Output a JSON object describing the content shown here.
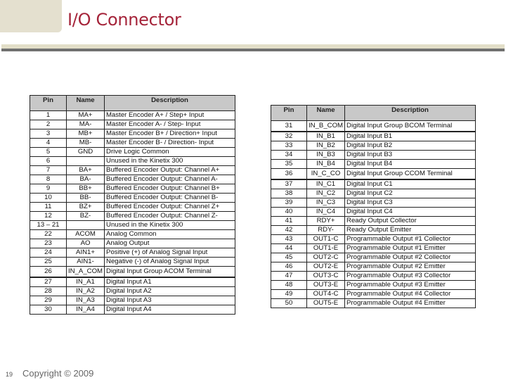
{
  "header": {
    "title": "I/O Connector"
  },
  "tables": {
    "left": {
      "columns": [
        "Pin",
        "Name",
        "Description"
      ],
      "rows": [
        {
          "pin": "1",
          "name": "MA+",
          "desc": "Master Encoder A+ / Step+ Input"
        },
        {
          "pin": "2",
          "name": "MA-",
          "desc": "Master Encoder A- / Step- Input"
        },
        {
          "pin": "3",
          "name": "MB+",
          "desc": "Master Encoder B+ / Direction+ Input"
        },
        {
          "pin": "4",
          "name": "MB-",
          "desc": "Master Encoder B- / Direction- Input"
        },
        {
          "pin": "5",
          "name": "GND",
          "desc": "Drive Logic Common"
        },
        {
          "pin": "6",
          "name": "",
          "desc": "Unused in the Kinetix 300"
        },
        {
          "pin": "7",
          "name": "BA+",
          "desc": "Buffered Encoder Output: Channel A+"
        },
        {
          "pin": "8",
          "name": "BA-",
          "desc": "Buffered Encoder Output: Channel A-"
        },
        {
          "pin": "9",
          "name": "BB+",
          "desc": "Buffered Encoder Output: Channel B+"
        },
        {
          "pin": "10",
          "name": "BB-",
          "desc": "Buffered Encoder Output: Channel B-"
        },
        {
          "pin": "11",
          "name": "BZ+",
          "desc": "Buffered Encoder Output: Channel Z+"
        },
        {
          "pin": "12",
          "name": "BZ-",
          "desc": "Buffered Encoder Output: Channel Z-"
        },
        {
          "pin": "13 – 21",
          "name": "",
          "desc": "Unused in the Kinetix 300"
        },
        {
          "pin": "22",
          "name": "ACOM",
          "desc": "Analog Common"
        },
        {
          "pin": "23",
          "name": "AO",
          "desc": "Analog Output"
        },
        {
          "pin": "24",
          "name": "AIN1+",
          "desc": "Positive (+) of Analog Signal Input"
        },
        {
          "pin": "25",
          "name": "AIN1-",
          "desc": "Negative (-) of Analog Signal Input"
        },
        {
          "pin": "26",
          "name": "IN_A_COM",
          "desc": "Digital Input Group ACOM Terminal"
        },
        {
          "pin": "27",
          "name": "IN_A1",
          "desc": "Digital Input A1"
        },
        {
          "pin": "28",
          "name": "IN_A2",
          "desc": "Digital Input A2"
        },
        {
          "pin": "29",
          "name": "IN_A3",
          "desc": "Digital Input A3"
        },
        {
          "pin": "30",
          "name": "IN_A4",
          "desc": "Digital Input A4"
        }
      ]
    },
    "right": {
      "columns": [
        "Pin",
        "Name",
        "Description"
      ],
      "rows": [
        {
          "pin": "31",
          "name": "IN_B_COM",
          "desc": "Digital Input Group BCOM Terminal"
        },
        {
          "pin": "32",
          "name": "IN_B1",
          "desc": "Digital Input B1"
        },
        {
          "pin": "33",
          "name": "IN_B2",
          "desc": "Digital Input B2"
        },
        {
          "pin": "34",
          "name": "IN_B3",
          "desc": "Digital Input B3"
        },
        {
          "pin": "35",
          "name": "IN_B4",
          "desc": "Digital Input B4"
        },
        {
          "pin": "36",
          "name": "IN_C_CO",
          "desc": "Digital Input Group CCOM Terminal"
        },
        {
          "pin": "37",
          "name": "IN_C1",
          "desc": "Digital Input C1"
        },
        {
          "pin": "38",
          "name": "IN_C2",
          "desc": "Digital Input C2"
        },
        {
          "pin": "39",
          "name": "IN_C3",
          "desc": "Digital Input C3"
        },
        {
          "pin": "40",
          "name": "IN_C4",
          "desc": "Digital Input C4"
        },
        {
          "pin": "41",
          "name": "RDY+",
          "desc": "Ready Output Collector"
        },
        {
          "pin": "42",
          "name": "RDY-",
          "desc": "Ready Output Emitter"
        },
        {
          "pin": "43",
          "name": "OUT1-C",
          "desc": "Programmable Output #1 Collector"
        },
        {
          "pin": "44",
          "name": "OUT1-E",
          "desc": "Programmable Output #1 Emitter"
        },
        {
          "pin": "45",
          "name": "OUT2-C",
          "desc": "Programmable Output #2 Collector"
        },
        {
          "pin": "46",
          "name": "OUT2-E",
          "desc": "Programmable Output #2 Emitter"
        },
        {
          "pin": "47",
          "name": "OUT3-C",
          "desc": "Programmable Output #3 Collector"
        },
        {
          "pin": "48",
          "name": "OUT3-E",
          "desc": "Programmable Output #3 Emitter"
        },
        {
          "pin": "49",
          "name": "OUT4-C",
          "desc": "Programmable Output #4 Collector"
        },
        {
          "pin": "50",
          "name": "OUT5-E",
          "desc": "Programmable Output #4 Emitter"
        }
      ]
    }
  },
  "footer": {
    "page_number": "19",
    "copyright": "Copyright © 2009"
  },
  "colors": {
    "title": "#a5243a",
    "header_fill": "#c8c8c8",
    "accent_band": "#e2dec8",
    "rule": "#707070"
  }
}
